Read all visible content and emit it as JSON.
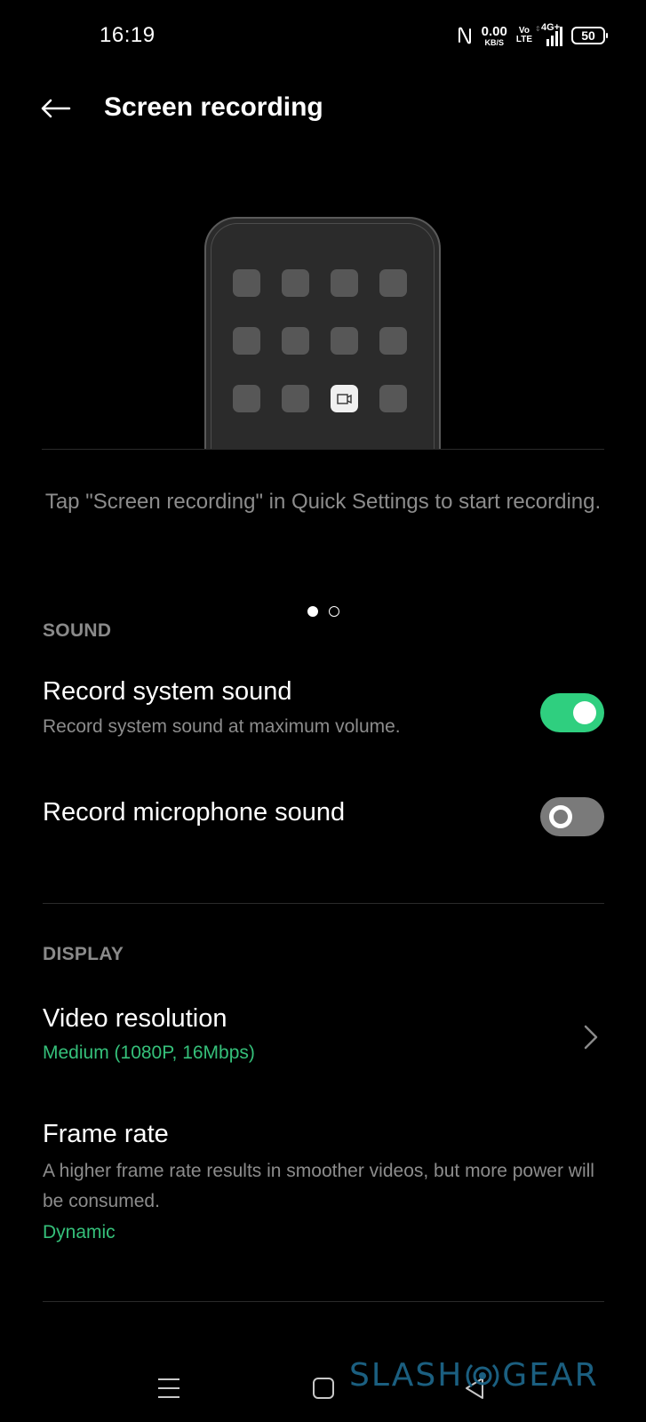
{
  "status_bar": {
    "time": "16:19",
    "net_speed_value": "0.00",
    "net_speed_unit": "KB/S",
    "volte_top": "Vo",
    "volte_bottom": "LTE",
    "network_type": "4G+",
    "battery_level": "50",
    "icons": [
      "nfc-icon",
      "volte-icon",
      "signal-icon",
      "battery-icon"
    ]
  },
  "header": {
    "title": "Screen recording",
    "back_icon": "arrow-left-icon"
  },
  "illustration": {
    "grid_rows": 3,
    "grid_cols": 4,
    "active_tile": {
      "row": 2,
      "col": 2,
      "icon": "screen-record-icon"
    }
  },
  "caption": "Tap \"Screen recording\" in Quick Settings to start recording.",
  "pager": {
    "pages": 2,
    "current": 0
  },
  "sections": {
    "sound": {
      "label": "SOUND",
      "items": [
        {
          "title": "Record system sound",
          "subtitle": "Record system sound at maximum volume.",
          "toggle": true
        },
        {
          "title": "Record microphone sound",
          "toggle": false
        }
      ]
    },
    "display": {
      "label": "DISPLAY",
      "items": [
        {
          "title": "Video resolution",
          "value": "Medium (1080P, 16Mbps)",
          "icon": "chevron-right-icon"
        },
        {
          "title": "Frame rate",
          "subtitle": "A higher frame rate results in smoother videos, but more power will be consumed.",
          "value": "Dynamic"
        }
      ]
    }
  },
  "colors": {
    "accent": "#2fcf7f",
    "value_text": "#35c07a",
    "toggle_off": "#7a7a7a",
    "secondary_text": "#8c8c8c"
  },
  "nav_bar": {
    "menu_icon": "menu-icon",
    "home_icon": "home-icon",
    "back_icon": "back-triangle-icon"
  },
  "watermark": {
    "left": "SLASH",
    "right": "GEAR"
  }
}
